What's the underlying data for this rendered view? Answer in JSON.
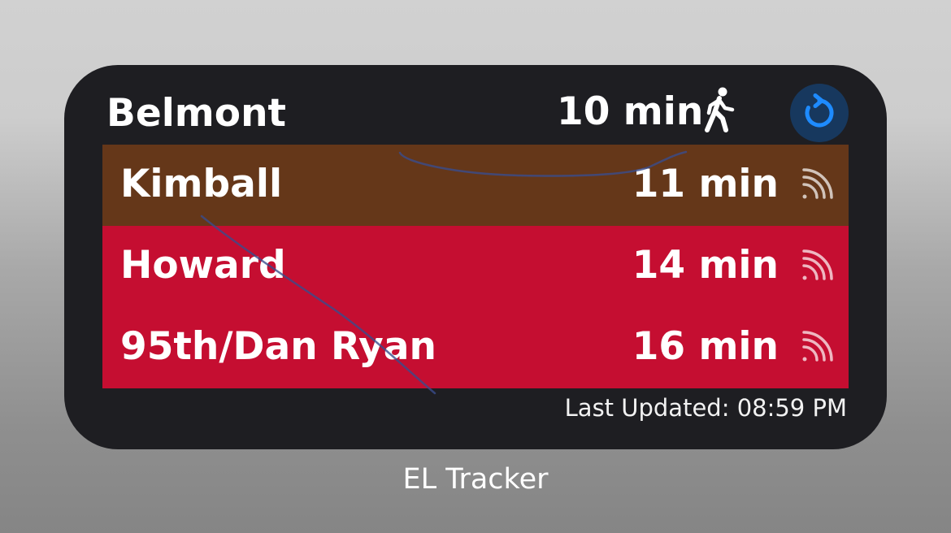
{
  "widget": {
    "station": "Belmont",
    "walk_time": "10 min",
    "walk_icon": "walking-person-icon",
    "refresh_icon": "refresh-icon",
    "refresh_color": "#1e8bff",
    "background": "#1e1e22",
    "arrivals": [
      {
        "destination": "Kimball",
        "eta": "11 min",
        "line": "Brown",
        "color": "#653719",
        "live_icon": "live-tracking-icon"
      },
      {
        "destination": "Howard",
        "eta": "14 min",
        "line": "Red",
        "color": "#c50e31",
        "live_icon": "live-tracking-icon"
      },
      {
        "destination": "95th/Dan Ryan",
        "eta": "16 min",
        "line": "Red",
        "color": "#c50e31",
        "live_icon": "live-tracking-icon"
      }
    ],
    "last_updated": "Last Updated: 08:59 PM"
  },
  "app_name": "EL Tracker"
}
